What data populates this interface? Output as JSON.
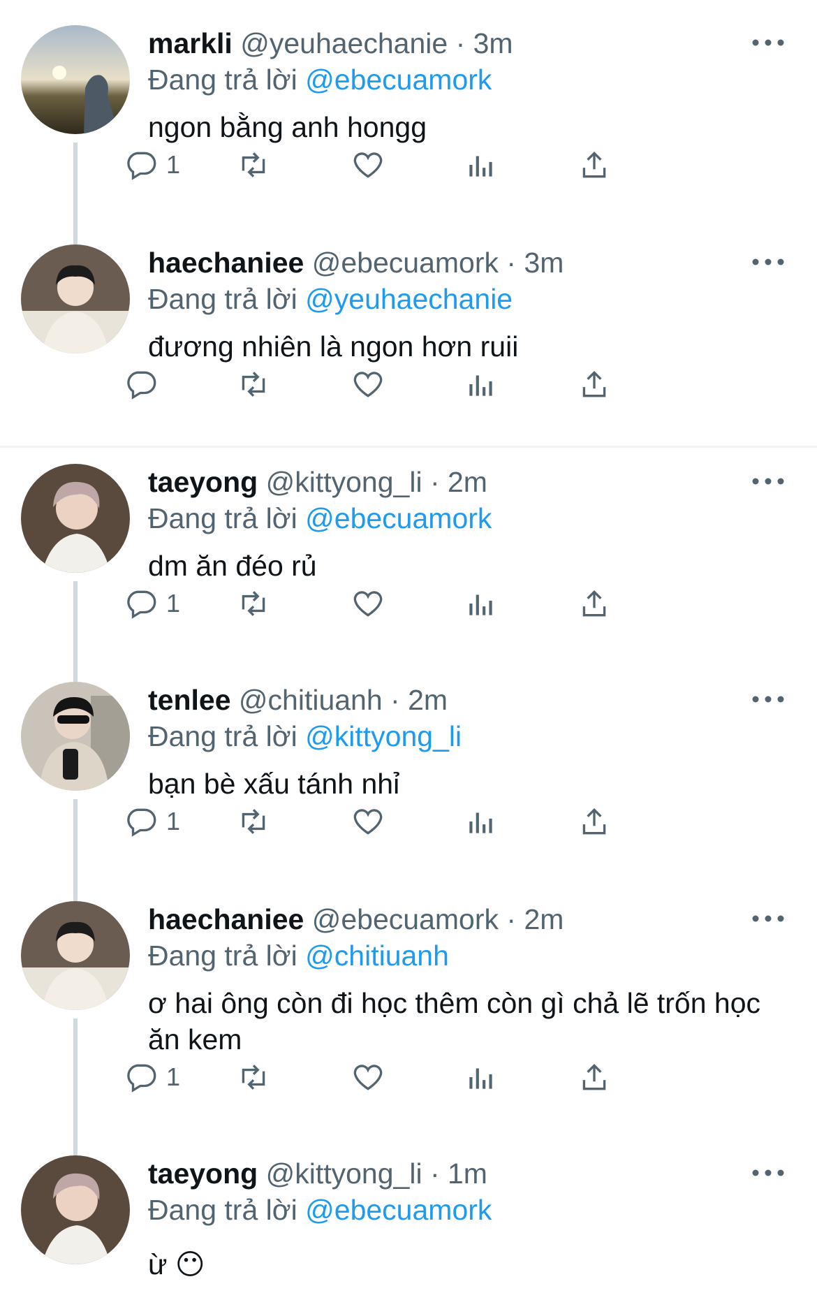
{
  "tweets": [
    {
      "name": "markli",
      "handle": "@yeuhaechanie",
      "time": "3m",
      "reply_prefix": "Đang trả lời",
      "reply_to": "@ebecuamork",
      "text": "ngon bằng anh hongg",
      "reply_count": "1"
    },
    {
      "name": "haechaniee",
      "handle": "@ebecuamork",
      "time": "3m",
      "reply_prefix": "Đang trả lời",
      "reply_to": "@yeuhaechanie",
      "text": "đương nhiên là ngon hơn ruii",
      "reply_count": ""
    },
    {
      "name": "taeyong",
      "handle": "@kittyong_li",
      "time": "2m",
      "reply_prefix": "Đang trả lời",
      "reply_to": "@ebecuamork",
      "text": "dm ăn đéo rủ",
      "reply_count": "1"
    },
    {
      "name": "tenlee",
      "handle": "@chitiuanh",
      "time": "2m",
      "reply_prefix": "Đang trả lời",
      "reply_to": "@kittyong_li",
      "text": "bạn bè xấu tánh nhỉ",
      "reply_count": "1"
    },
    {
      "name": "haechaniee",
      "handle": "@ebecuamork",
      "time": "2m",
      "reply_prefix": "Đang trả lời",
      "reply_to": "@chitiuanh",
      "text": "ơ hai ông còn đi học thêm còn gì chả lẽ trốn học ăn kem",
      "reply_count": "1"
    },
    {
      "name": "taeyong",
      "handle": "@kittyong_li",
      "time": "1m",
      "reply_prefix": "Đang trả lời",
      "reply_to": "@ebecuamork",
      "text": "ừ 😶",
      "reply_count": ""
    }
  ],
  "colors": {
    "accent": "#1d9bf0",
    "muted": "#536471",
    "text": "#0f1419",
    "line": "#cfd9de"
  },
  "icons": [
    "reply-icon",
    "retweet-icon",
    "like-icon",
    "views-icon",
    "share-icon",
    "more-icon"
  ]
}
